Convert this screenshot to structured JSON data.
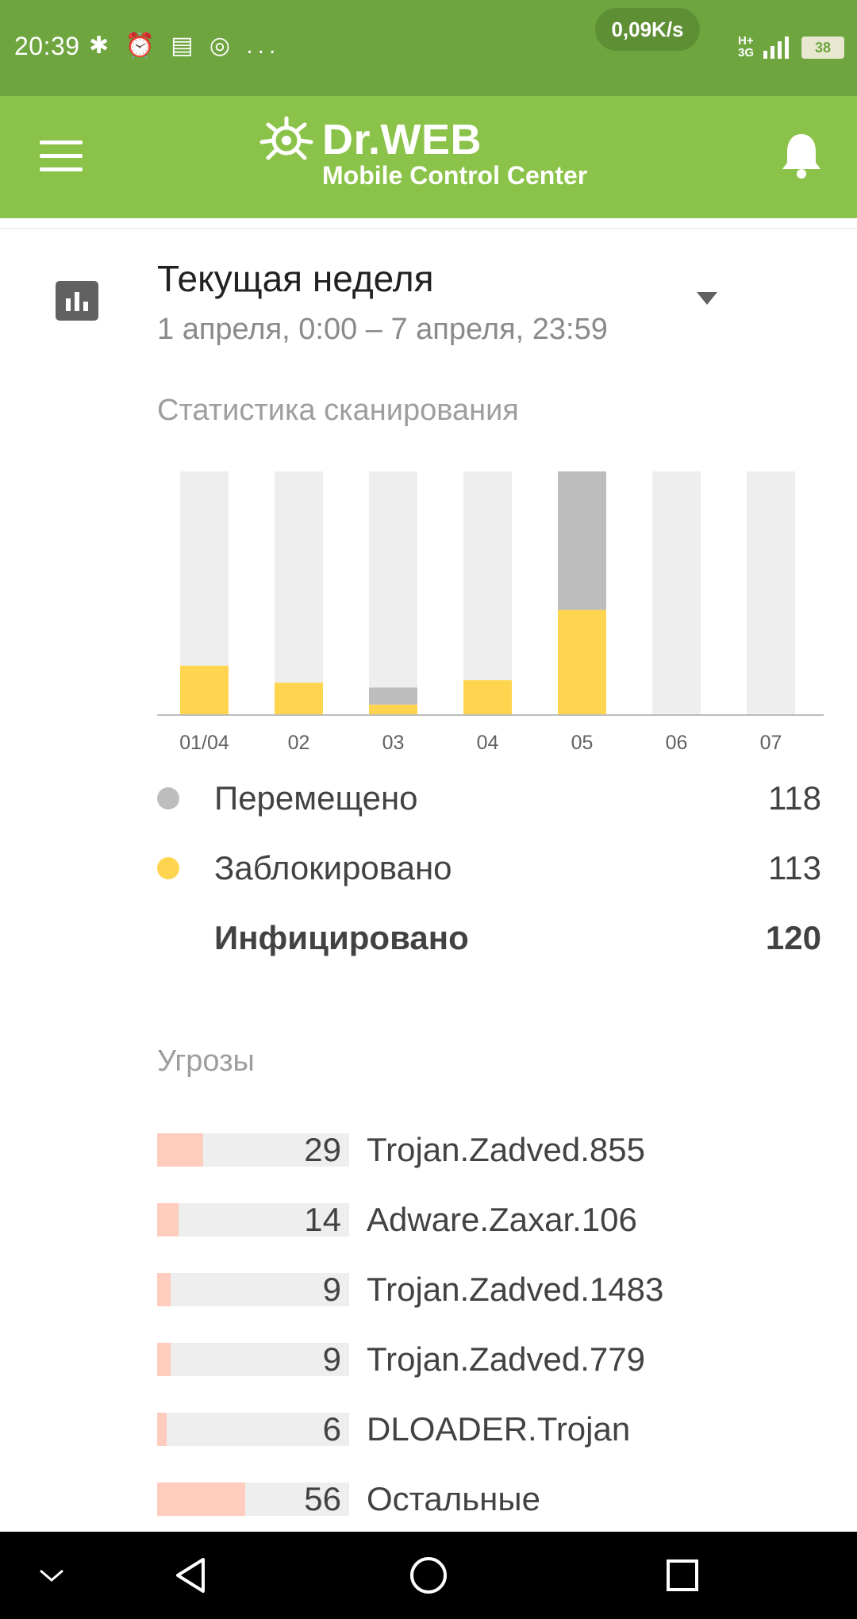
{
  "status_bar": {
    "time": "20:39",
    "icons_text": "✱ ⏰ ▤ ◎ ...",
    "speed": "0,09K/s",
    "network": "H+",
    "network2": "3G",
    "battery": "38"
  },
  "app_bar": {
    "logo_name": "Dr.WEB",
    "logo_subtitle": "Mobile Control Center",
    "menu_icon": "hamburger-menu-icon",
    "notifications_icon": "bell-icon"
  },
  "period": {
    "title": "Текущая неделя",
    "range": "1 апреля, 0:00 – 7 апреля, 23:59"
  },
  "scan_section_label": "Статистика сканирования",
  "chart_data": {
    "type": "bar",
    "stacked": true,
    "categories": [
      "01/04",
      "02",
      "03",
      "04",
      "05",
      "06",
      "07"
    ],
    "series": [
      {
        "name": "Заблокировано",
        "color": "#ffd54f",
        "values": [
          20,
          13,
          4,
          14,
          43,
          0,
          0
        ]
      },
      {
        "name": "Перемещено",
        "color": "#bdbdbd",
        "values": [
          0,
          0,
          7,
          0,
          57,
          0,
          0
        ]
      }
    ],
    "ylim": [
      0,
      100
    ],
    "track_color": "#eeeeee"
  },
  "legend": [
    {
      "label": "Перемещено",
      "value": "118",
      "color": "#bdbdbd"
    },
    {
      "label": "Заблокировано",
      "value": "113",
      "color": "#ffd54f"
    }
  ],
  "total": {
    "label": "Инфицировано",
    "value": "120"
  },
  "threats_section_label": "Угрозы",
  "threats": [
    {
      "count": "29",
      "name": "Trojan.Zadved.855",
      "share": 0.24
    },
    {
      "count": "14",
      "name": "Adware.Zaxar.106",
      "share": 0.11
    },
    {
      "count": "9",
      "name": "Trojan.Zadved.1483",
      "share": 0.07
    },
    {
      "count": "9",
      "name": "Trojan.Zadved.779",
      "share": 0.07
    },
    {
      "count": "6",
      "name": "DLOADER.Trojan",
      "share": 0.05
    },
    {
      "count": "56",
      "name": "Остальные",
      "share": 0.46
    }
  ],
  "nav_bar": {
    "hide_icon": "chevron-down-icon",
    "back_icon": "back-triangle-icon",
    "home_icon": "home-circle-icon",
    "recents_icon": "recents-square-icon"
  }
}
